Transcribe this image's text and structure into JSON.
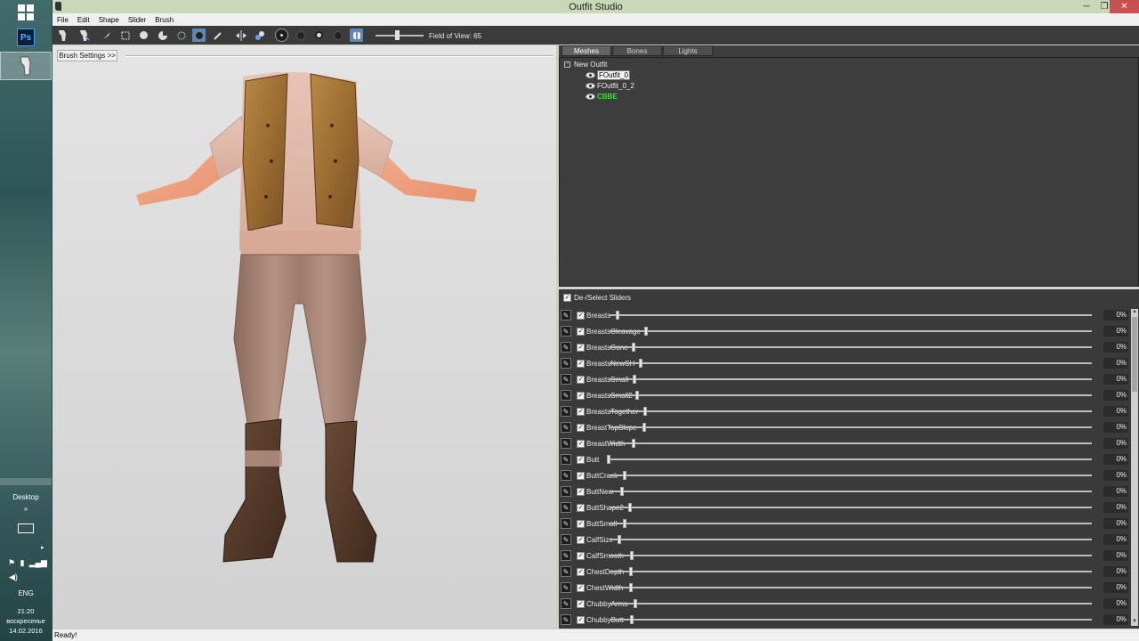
{
  "taskbar": {
    "ps_label": "Ps",
    "desktop_label": "Desktop",
    "chevron": "»",
    "tray_arrow": "▸",
    "language": "ENG",
    "time": "21:20",
    "weekday": "воскресенье",
    "date": "14.02.2016"
  },
  "window": {
    "title": "Outfit Studio",
    "minimize": "─",
    "maximize": "❐",
    "close": "✕"
  },
  "menu": [
    "File",
    "Edit",
    "Shape",
    "Slider",
    "Brush"
  ],
  "toolbar": {
    "fov_label": "Field of View: 65",
    "fov_value": 65
  },
  "viewport": {
    "brush_settings_label": "Brush Settings >>"
  },
  "tabs": [
    "Meshes",
    "Bones",
    "Lights"
  ],
  "tree": {
    "root": "New Outfit",
    "collapse": "−",
    "shapes": [
      "FOutfit_0",
      "FOutfit_0_2",
      "CBBE"
    ]
  },
  "sliders": {
    "header": "De-/Select Sliders",
    "check": "✓",
    "items": [
      {
        "name": "Breasts",
        "value": "0%"
      },
      {
        "name": "BreastsCleavage",
        "value": "0%"
      },
      {
        "name": "BreastsGone",
        "value": "0%"
      },
      {
        "name": "BreastsNewSH",
        "value": "0%"
      },
      {
        "name": "BreastsSmall",
        "value": "0%"
      },
      {
        "name": "BreastsSmall2",
        "value": "0%"
      },
      {
        "name": "BreastsTogether",
        "value": "0%"
      },
      {
        "name": "BreastTopSlope",
        "value": "0%"
      },
      {
        "name": "BreastWidth",
        "value": "0%"
      },
      {
        "name": "Butt",
        "value": "0%"
      },
      {
        "name": "ButtCrack",
        "value": "0%"
      },
      {
        "name": "ButtNew",
        "value": "0%"
      },
      {
        "name": "ButtShape2",
        "value": "0%"
      },
      {
        "name": "ButtSmall",
        "value": "0%"
      },
      {
        "name": "CalfSize",
        "value": "0%"
      },
      {
        "name": "CalfSmooth",
        "value": "0%"
      },
      {
        "name": "ChestDepth",
        "value": "0%"
      },
      {
        "name": "ChestWidth",
        "value": "0%"
      },
      {
        "name": "ChubbyArms",
        "value": "0%"
      },
      {
        "name": "ChubbyButt",
        "value": "0%"
      }
    ]
  },
  "status": "Ready!"
}
